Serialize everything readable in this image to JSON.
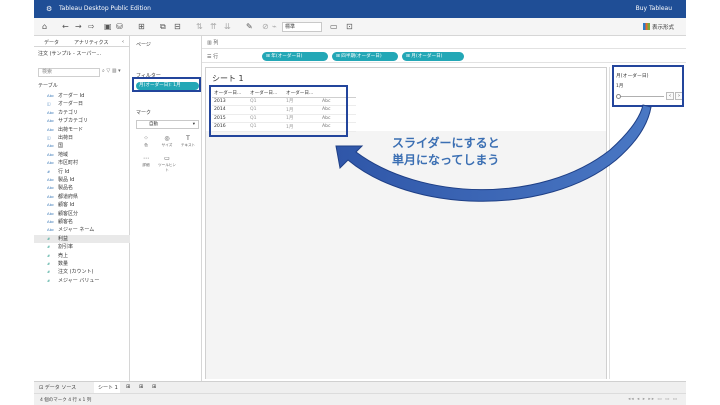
{
  "titlebar": {
    "logo": "⚙",
    "title": "Tableau Desktop Public Edition",
    "buy": "Buy Tableau"
  },
  "toolbar": {
    "format_value": "標準",
    "show_me": "表示形式"
  },
  "datapane": {
    "tabs": [
      "データ",
      "アナリティクス"
    ],
    "collapse": "‹",
    "source": "注文 (サンプル - スーパー...",
    "search_placeholder": "検索",
    "tools": "⌕ ▽ ▥ ▾",
    "tables_header": "テーブル",
    "fields": [
      {
        "type": "Abc",
        "name": "オーダー Id",
        "kind": "dim"
      },
      {
        "type": "◫",
        "name": "オーダー日",
        "kind": "dim"
      },
      {
        "type": "Abc",
        "name": "カテゴリ",
        "kind": "dim"
      },
      {
        "type": "Abc",
        "name": "サブカテゴリ",
        "kind": "dim"
      },
      {
        "type": "Abc",
        "name": "出荷モード",
        "kind": "dim"
      },
      {
        "type": "◫",
        "name": "出荷日",
        "kind": "dim"
      },
      {
        "type": "Abc",
        "name": "国",
        "kind": "dim"
      },
      {
        "type": "Abc",
        "name": "地域",
        "kind": "dim"
      },
      {
        "type": "Abc",
        "name": "市区町村",
        "kind": "dim"
      },
      {
        "type": "#",
        "name": "行 Id",
        "kind": "dim"
      },
      {
        "type": "Abc",
        "name": "製品 Id",
        "kind": "dim"
      },
      {
        "type": "Abc",
        "name": "製品名",
        "kind": "dim"
      },
      {
        "type": "Abc",
        "name": "都道府県",
        "kind": "dim"
      },
      {
        "type": "Abc",
        "name": "顧客 Id",
        "kind": "dim"
      },
      {
        "type": "Abc",
        "name": "顧客区分",
        "kind": "dim"
      },
      {
        "type": "Abc",
        "name": "顧客名",
        "kind": "dim"
      },
      {
        "type": "Abc",
        "name": "メジャー ネーム",
        "kind": "dim"
      },
      {
        "type": "#",
        "name": "利益",
        "kind": "mea"
      },
      {
        "type": "#",
        "name": "割引率",
        "kind": "mea"
      },
      {
        "type": "#",
        "name": "売上",
        "kind": "mea"
      },
      {
        "type": "#",
        "name": "数量",
        "kind": "mea"
      },
      {
        "type": "#",
        "name": "注文 (カウント)",
        "kind": "mea"
      },
      {
        "type": "#",
        "name": "メジャー バリュー",
        "kind": "mea"
      }
    ]
  },
  "shelves": {
    "pages": "ページ",
    "filters": "フィルター",
    "filter_pill": "月(オーダー日): 1月",
    "marks": "マーク",
    "marks_type": "自動",
    "marks_buttons": [
      {
        "glyph": "⁘",
        "label": "色"
      },
      {
        "glyph": "◎",
        "label": "サイズ"
      },
      {
        "glyph": "T",
        "label": "テキスト"
      },
      {
        "glyph": "⋯",
        "label": "詳細"
      },
      {
        "glyph": "▭",
        "label": "ツールヒント"
      }
    ],
    "columns_label": "▥ 列",
    "rows_label": "☰ 行",
    "row_pills": [
      "⊞ 年(オーダー日)",
      "⊞ 四半期(オーダー日)",
      "⊞ 月(オーダー日)"
    ]
  },
  "sheet": {
    "title": "シート 1",
    "headers": [
      "オーダー日...",
      "オーダー日...",
      "オーダー日...",
      ""
    ],
    "rows": [
      [
        "2013",
        "Q1",
        "1月",
        "Abc"
      ],
      [
        "2014",
        "Q1",
        "1月",
        "Abc"
      ],
      [
        "2015",
        "Q1",
        "1月",
        "Abc"
      ],
      [
        "2016",
        "Q1",
        "1月",
        "Abc"
      ]
    ]
  },
  "filter_card": {
    "title": "月(オーダー日)",
    "value": "1月",
    "prev": "‹",
    "next": "›"
  },
  "annotation": {
    "line1": "スライダーにすると",
    "line2": "単月になってしまう"
  },
  "bottom_tabs": {
    "data_source": "⊡ データ ソース",
    "sheet": "シート 1"
  },
  "status": {
    "text": "4 個のマーク  4 行 x 1 列",
    "nav": "◂◂ ◂ ▸ ▸▸ ▭ ▭ ▭"
  },
  "colors": {
    "titlebar": "#1f4e96",
    "pill": "#23a7b6",
    "highlight": "#23459c",
    "annotation": "#3b6fb3"
  }
}
